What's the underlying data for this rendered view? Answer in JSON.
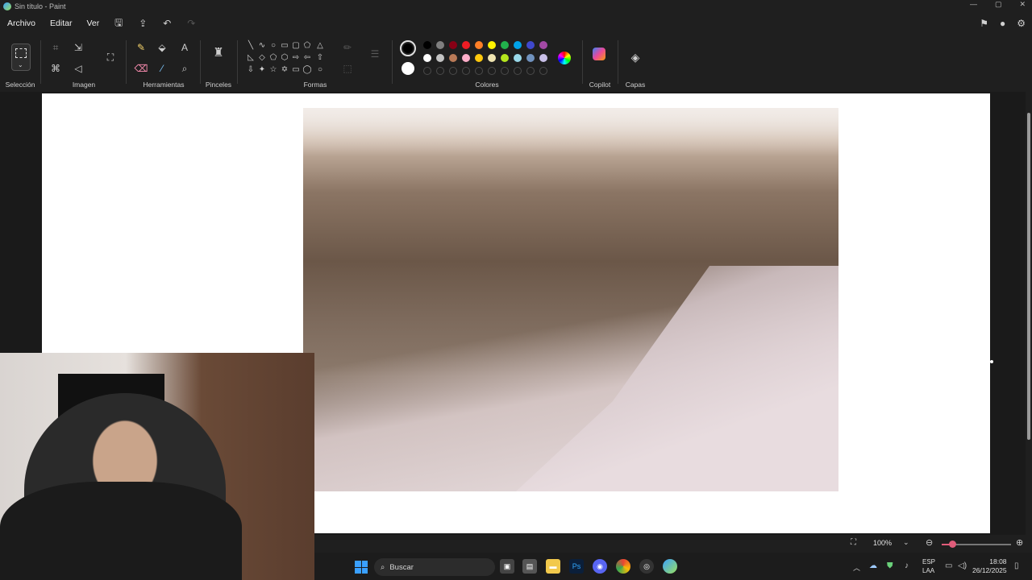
{
  "window": {
    "title": "Sin título - Paint"
  },
  "menu": {
    "file": "Archivo",
    "edit": "Editar",
    "view": "Ver"
  },
  "ribbon": {
    "selection": "Selección",
    "image": "Imagen",
    "tools": "Herramientas",
    "brushes": "Pinceles",
    "shapes": "Formas",
    "colors": "Colores",
    "copilot": "Copilot",
    "layers": "Capas"
  },
  "palette": {
    "primary": "#000000",
    "secondary": "#ffffff",
    "row1": [
      "#000000",
      "#7f7f7f",
      "#880015",
      "#ed1c24",
      "#ff7f27",
      "#fff200",
      "#22b14c",
      "#00a2e8",
      "#3f48cc",
      "#a349a4"
    ],
    "row2": [
      "#ffffff",
      "#c3c3c3",
      "#b97a57",
      "#ffaec9",
      "#ffc90e",
      "#efe4b0",
      "#b5e61d",
      "#99d9ea",
      "#7092be",
      "#c8bfe7"
    ]
  },
  "status": {
    "zoom": "100%",
    "zoom_level": 0.15
  },
  "taskbar": {
    "search_placeholder": "Buscar",
    "lang1": "ESP",
    "lang2": "LAA",
    "time": "18:08",
    "date": "26/12/2025"
  }
}
